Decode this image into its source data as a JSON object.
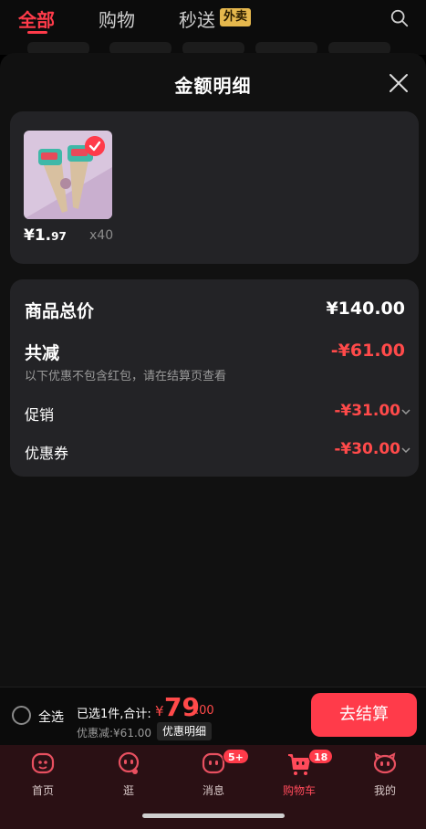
{
  "top_tabs": [
    {
      "label": "全部",
      "active": true
    },
    {
      "label": "购物",
      "active": false
    },
    {
      "label": "秒送",
      "active": false
    }
  ],
  "waimai_badge": "外卖",
  "sheet": {
    "title": "金额明细"
  },
  "product": {
    "price_symbol": "¥",
    "price_int": "1.",
    "price_dec": "97",
    "quantity": "x40"
  },
  "summary": {
    "total_label": "商品总价",
    "total_value": "¥140.00",
    "reduce_label": "共减",
    "reduce_value": "-¥61.00",
    "note": "以下优惠不包含红包，请在结算页查看",
    "promo_label": "促销",
    "promo_value": "-¥31.00",
    "coupon_label": "优惠券",
    "coupon_value": "-¥30.00"
  },
  "checkout": {
    "select_all": "全选",
    "selected_text": "已选1件,合计:",
    "total_symbol": "¥",
    "total_int": "79",
    "total_dec": ".00",
    "discount_text": "优惠减:¥61.00",
    "detail_chip": "优惠明细",
    "button": "去结算"
  },
  "bottom_nav": [
    {
      "label": "首页",
      "icon": "home-face-icon",
      "active": false
    },
    {
      "label": "逛",
      "icon": "stroll-face-icon",
      "active": false
    },
    {
      "label": "消息",
      "icon": "message-face-icon",
      "active": false,
      "badge": "5+"
    },
    {
      "label": "购物车",
      "icon": "cart-icon",
      "active": true,
      "badge": "18"
    },
    {
      "label": "我的",
      "icon": "profile-face-icon",
      "active": false
    }
  ],
  "colors": {
    "accent": "#ff3b4a",
    "discount_red": "#ff4a4a",
    "card_bg": "#232326",
    "sheet_bg": "#111111"
  }
}
